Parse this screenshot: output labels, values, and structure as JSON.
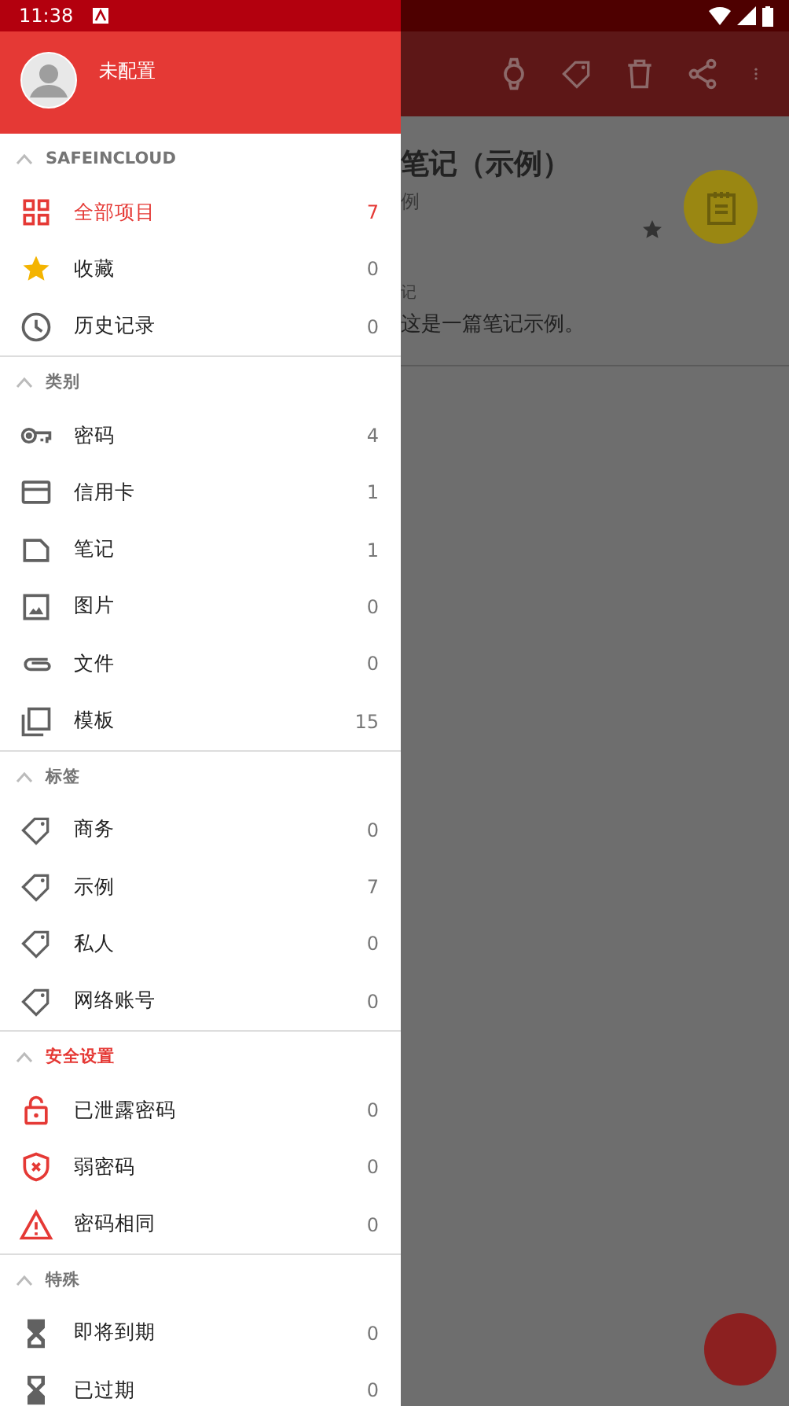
{
  "status_bar": {
    "time": "11:38"
  },
  "main_view": {
    "title": "笔记（示例）",
    "subtitle": "例",
    "starred": true,
    "field_label": "记",
    "field_value": "这是一篇笔记示例。"
  },
  "drawer": {
    "account": {
      "name": "未配置"
    },
    "sections": [
      {
        "title": "SAFEINCLOUD",
        "expanded": true,
        "color": "#757575",
        "items": [
          {
            "kind": "grid",
            "label": "全部项目",
            "count": "7",
            "selected": true
          },
          {
            "kind": "star",
            "label": "收藏",
            "count": "0",
            "selected": false
          },
          {
            "kind": "clock",
            "label": "历史记录",
            "count": "0",
            "selected": false
          }
        ]
      },
      {
        "title": "类别",
        "expanded": true,
        "color": "#757575",
        "items": [
          {
            "kind": "key",
            "label": "密码",
            "count": "4",
            "selected": false
          },
          {
            "kind": "card",
            "label": "信用卡",
            "count": "1",
            "selected": false
          },
          {
            "kind": "note",
            "label": "笔记",
            "count": "1",
            "selected": false
          },
          {
            "kind": "image",
            "label": "图片",
            "count": "0",
            "selected": false
          },
          {
            "kind": "clip",
            "label": "文件",
            "count": "0",
            "selected": false
          },
          {
            "kind": "template",
            "label": "模板",
            "count": "15",
            "selected": false
          }
        ]
      },
      {
        "title": "标签",
        "expanded": true,
        "color": "#757575",
        "items": [
          {
            "kind": "tag",
            "label": "商务",
            "count": "0",
            "selected": false
          },
          {
            "kind": "tag",
            "label": "示例",
            "count": "7",
            "selected": false
          },
          {
            "kind": "tag",
            "label": "私人",
            "count": "0",
            "selected": false
          },
          {
            "kind": "tag",
            "label": "网络账号",
            "count": "0",
            "selected": false
          }
        ]
      },
      {
        "title": "安全设置",
        "expanded": true,
        "color": "#e53935",
        "items": [
          {
            "kind": "lock",
            "label": "已泄露密码",
            "count": "0",
            "selected": false
          },
          {
            "kind": "shield",
            "label": "弱密码",
            "count": "0",
            "selected": false
          },
          {
            "kind": "warning",
            "label": "密码相同",
            "count": "0",
            "selected": false
          }
        ]
      },
      {
        "title": "特殊",
        "expanded": true,
        "color": "#757575",
        "items": [
          {
            "kind": "hourglass",
            "label": "即将到期",
            "count": "0",
            "selected": false
          },
          {
            "kind": "hourglass-done",
            "label": "已过期",
            "count": "0",
            "selected": false
          }
        ]
      }
    ]
  }
}
